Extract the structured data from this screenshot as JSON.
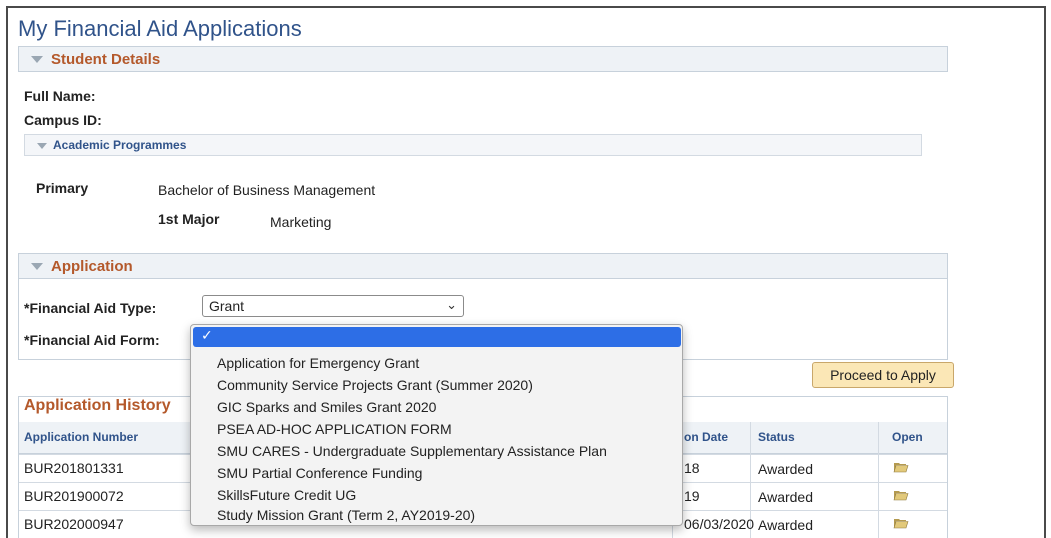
{
  "page": {
    "title": "My Financial Aid Applications"
  },
  "student_details": {
    "section_label": "Student Details",
    "full_name_label": "Full Name:",
    "campus_id_label": "Campus ID:",
    "academic_programmes": {
      "section_label": "Academic Programmes",
      "primary_label": "Primary",
      "primary_value": "Bachelor of Business Management",
      "major_label": "1st Major",
      "major_value": "Marketing"
    }
  },
  "application": {
    "section_label": "Application",
    "aid_type_label": "*Financial Aid Type:",
    "aid_type_value": "Grant",
    "aid_form_label": "*Financial Aid Form:",
    "aid_form_options": [
      "Application for Emergency Grant",
      "Community Service Projects Grant (Summer 2020)",
      "GIC Sparks and Smiles Grant 2020",
      "PSEA AD-HOC APPLICATION FORM",
      "SMU CARES - Undergraduate Supplementary Assistance Plan",
      "SMU Partial Conference Funding",
      "SkillsFuture Credit UG",
      "Study Mission Grant (Term 2, AY2019-20)"
    ],
    "proceed_label": "Proceed to Apply"
  },
  "history": {
    "title": "Application History",
    "headers": {
      "number": "Application Number",
      "date": "on Date",
      "status": "Status",
      "open": "Open"
    },
    "rows": [
      {
        "number": "BUR201801331",
        "date": "18",
        "status": "Awarded"
      },
      {
        "number": "BUR201900072",
        "date": "19",
        "status": "Awarded"
      },
      {
        "number": "BUR202000947",
        "date": "06/03/2020",
        "status": "Awarded"
      }
    ]
  },
  "icons": {
    "open": "folder-open-icon",
    "check": "checkmark-icon",
    "chevron": "chevron-down-icon",
    "collapse": "collapse-triangle-icon"
  },
  "colors": {
    "title": "#30538a",
    "section_label": "#b4592b",
    "selected_option": "#2d6ee6",
    "button": "#fbe7b6"
  }
}
